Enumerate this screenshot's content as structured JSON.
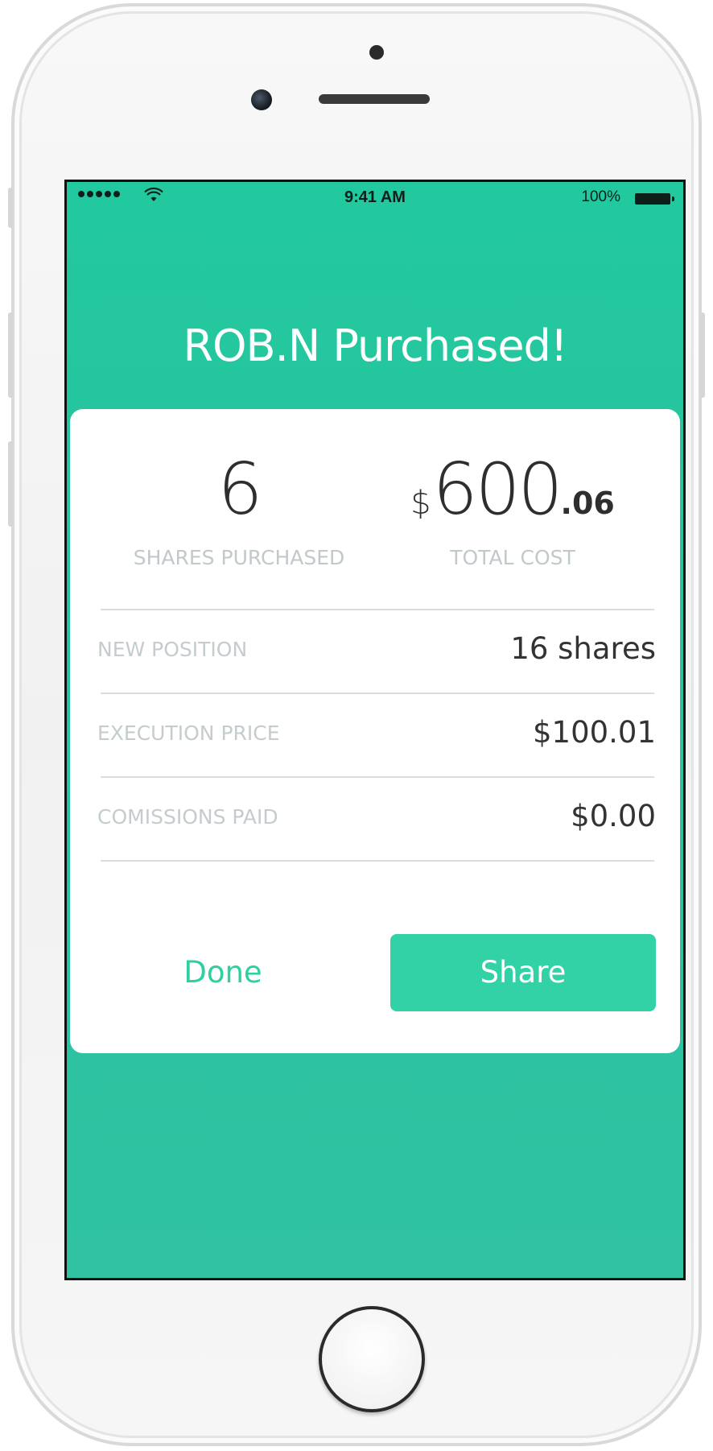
{
  "status_bar": {
    "time": "9:41 AM",
    "battery": "100%",
    "icons": [
      "signal-dots-icon",
      "wifi-icon",
      "battery-icon"
    ]
  },
  "headline": "ROB.N Purchased!",
  "summary": {
    "shares": {
      "value": "6",
      "label": "SHARES PURCHASED"
    },
    "total_cost": {
      "currency": "$",
      "whole": "600",
      "cents": ".06",
      "label": "TOTAL COST"
    }
  },
  "details": [
    {
      "label": "NEW POSITION",
      "value": "16 shares"
    },
    {
      "label": "EXECUTION PRICE",
      "value": "$100.01"
    },
    {
      "label": "COMISSIONS PAID",
      "value": "$0.00"
    }
  ],
  "actions": {
    "done_label": "Done",
    "share_label": "Share"
  },
  "colors": {
    "accent": "#33d1a6",
    "screen_background": "#22c89e",
    "muted_label": "#c2c9cb"
  }
}
